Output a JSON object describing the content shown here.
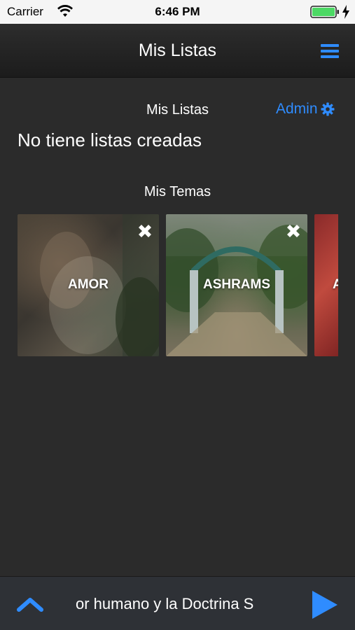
{
  "status_bar": {
    "carrier": "Carrier",
    "time": "6:46 PM",
    "battery_color": "#4cd964"
  },
  "nav": {
    "title": "Mis Listas",
    "menu_icon": "hamburger-menu-icon"
  },
  "lists_section": {
    "heading": "Mis Listas",
    "admin_label": "Admin",
    "empty_text": "No tiene listas creadas"
  },
  "topics_section": {
    "heading": "Mis Temas",
    "topics": [
      {
        "label": "AMOR"
      },
      {
        "label": "ASHRAMS"
      },
      {
        "label": "A"
      }
    ]
  },
  "player": {
    "track_title": "or humano y la Doctrina S"
  },
  "colors": {
    "accent": "#2f8cff",
    "background": "#2b2b2b",
    "player_background": "#2e3136"
  }
}
